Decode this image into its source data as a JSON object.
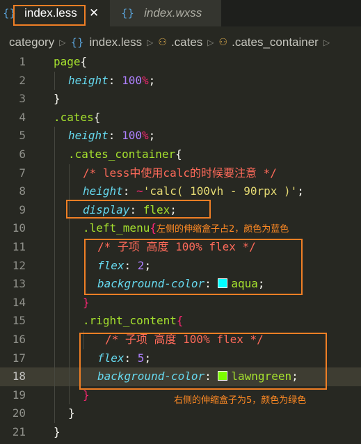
{
  "tabs": [
    {
      "icon": "{}",
      "label": "index.less",
      "close": "✕"
    },
    {
      "icon": "{}",
      "label": "index.wxss"
    }
  ],
  "breadcrumb": {
    "items": [
      {
        "label": "category"
      },
      {
        "icon": "{}",
        "label": "index.less"
      },
      {
        "label": ".cates"
      },
      {
        "label": ".cates_container"
      }
    ],
    "sep": "▷"
  },
  "lines": {
    "n": [
      "1",
      "2",
      "3",
      "4",
      "5",
      "6",
      "7",
      "8",
      "9",
      "10",
      "11",
      "12",
      "13",
      "14",
      "15",
      "16",
      "17",
      "18",
      "19",
      "20",
      "21"
    ],
    "l1": {
      "sel": "page",
      "p": "{"
    },
    "l2": {
      "prop": "height",
      "colon": ": ",
      "num": "100",
      "unit": "%",
      "semi": ";"
    },
    "l3": {
      "p": "}"
    },
    "l4": {
      "sel": ".cates",
      "p": "{"
    },
    "l5": {
      "prop": "height",
      "colon": ": ",
      "num": "100",
      "unit": "%",
      "semi": ";"
    },
    "l6": {
      "sel": ".cates_container",
      "p": "{"
    },
    "l7": {
      "comment": "/* less中使用calc的时候要注意 */"
    },
    "l8": {
      "prop": "height",
      "colon": ": ",
      "op": "~",
      "str": "'calc( 100vh - 90rpx )'",
      "semi": ";"
    },
    "l9": {
      "prop": "display",
      "colon": ": ",
      "val": "flex",
      "semi": ";"
    },
    "l10": {
      "sel": ".left_menu",
      "p": "{",
      "note": "左侧的伸缩盒子占2，颜色为蓝色"
    },
    "l11": {
      "comment": "/* 子项 高度 100% flex */"
    },
    "l12": {
      "prop": "flex",
      "colon": ": ",
      "num": "2",
      "semi": ";"
    },
    "l13": {
      "prop": "background-color",
      "colon": ": ",
      "color": "#00ffff",
      "val": "aqua",
      "semi": ";"
    },
    "l14": {
      "p": "}"
    },
    "l15": {
      "sel": ".right_content",
      "p": "{"
    },
    "l16": {
      "comment": "/* 子项 高度 100% flex */"
    },
    "l17": {
      "prop": "flex",
      "colon": ": ",
      "num": "5",
      "semi": ";"
    },
    "l18": {
      "prop": "background-color",
      "colon": ": ",
      "color": "#7cfc00",
      "val": "lawngreen",
      "semi": ";"
    },
    "l19": {
      "p": "}"
    },
    "l20": {
      "p": "}"
    },
    "l21": {
      "p": "}"
    }
  },
  "annotation_right": "右侧的伸缩盒子为5，颜色为绿色",
  "colors": {
    "annotation": "#f07f25",
    "background": "#272822",
    "aqua": "#00ffff",
    "lawngreen": "#7cfc00"
  }
}
